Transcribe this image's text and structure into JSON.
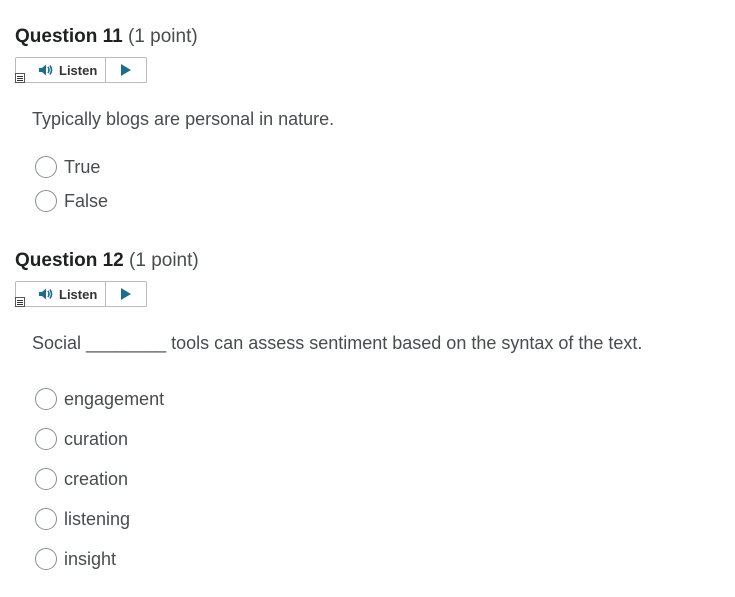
{
  "questions": [
    {
      "number_label": "Question 11",
      "points_label": "(1 point)",
      "listen_label": "Listen",
      "text": "Typically blogs are personal in nature.",
      "options": [
        "True",
        "False"
      ]
    },
    {
      "number_label": "Question 12",
      "points_label": "(1 point)",
      "listen_label": "Listen",
      "text_before": "Social",
      "blank": "________",
      "text_after": "tools can assess sentiment based on the syntax of the text.",
      "options": [
        "engagement",
        "curation",
        "creation",
        "listening",
        "insight"
      ]
    }
  ],
  "icons": {
    "speaker": "speaker-icon",
    "play": "play-icon",
    "menu": "menu-icon",
    "radio": "radio-button"
  },
  "colors": {
    "title": "#202122",
    "text": "#494c4e",
    "play": "#1f6c8c",
    "border": "#b8bcc0"
  }
}
